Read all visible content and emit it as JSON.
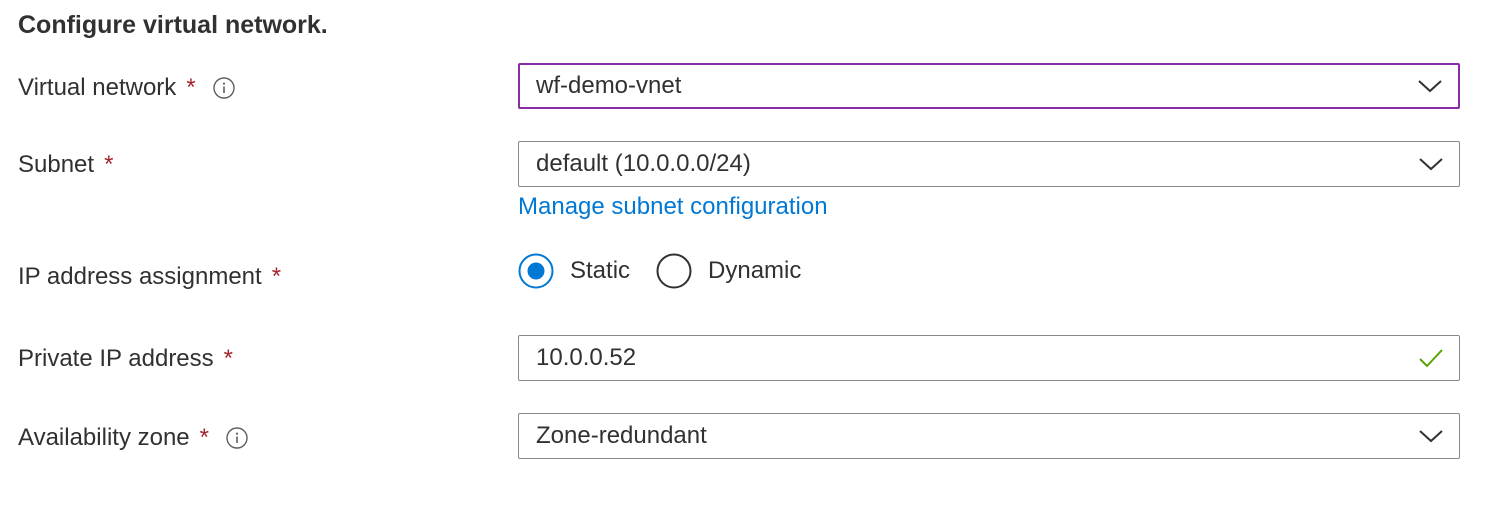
{
  "section": {
    "title": "Configure virtual network."
  },
  "required_marker": "*",
  "colors": {
    "required": "#a4262c",
    "link": "#0078d4",
    "focus_border": "#8a2da5",
    "radio_selected": "#0078d4",
    "valid_check": "#57a300"
  },
  "fields": {
    "virtual_network": {
      "label": "Virtual network",
      "value": "wf-demo-vnet",
      "info_icon": "info-icon",
      "trailing_icon": "chevron-down-icon",
      "focused": true
    },
    "subnet": {
      "label": "Subnet",
      "value": "default (10.0.0.0/24)",
      "trailing_icon": "chevron-down-icon",
      "link": "Manage subnet configuration"
    },
    "ip_assignment": {
      "label": "IP address assignment",
      "options": [
        {
          "label": "Static",
          "selected": true
        },
        {
          "label": "Dynamic",
          "selected": false
        }
      ]
    },
    "private_ip": {
      "label": "Private IP address",
      "value": "10.0.0.52",
      "trailing_icon": "checkmark-icon"
    },
    "availability_zone": {
      "label": "Availability zone",
      "value": "Zone-redundant",
      "info_icon": "info-icon",
      "trailing_icon": "chevron-down-icon"
    }
  }
}
